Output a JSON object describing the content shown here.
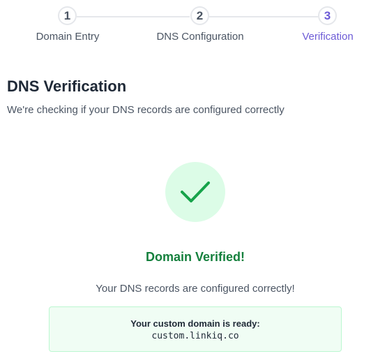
{
  "stepper": {
    "steps": [
      {
        "number": "1",
        "label": "Domain Entry",
        "state": "done"
      },
      {
        "number": "2",
        "label": "DNS Configuration",
        "state": "done"
      },
      {
        "number": "3",
        "label": "Verification",
        "state": "active"
      }
    ],
    "active_color": "#6d5bd6"
  },
  "header": {
    "title": "DNS Verification",
    "subtitle": "We're checking if your DNS records are configured correctly"
  },
  "status": {
    "icon": "checkmark-icon",
    "title": "Domain Verified!",
    "message": "Your DNS records are configured correctly!",
    "color": "#15803d"
  },
  "ready_box": {
    "label": "Your custom domain is ready:",
    "domain": "custom.linkiq.co"
  }
}
